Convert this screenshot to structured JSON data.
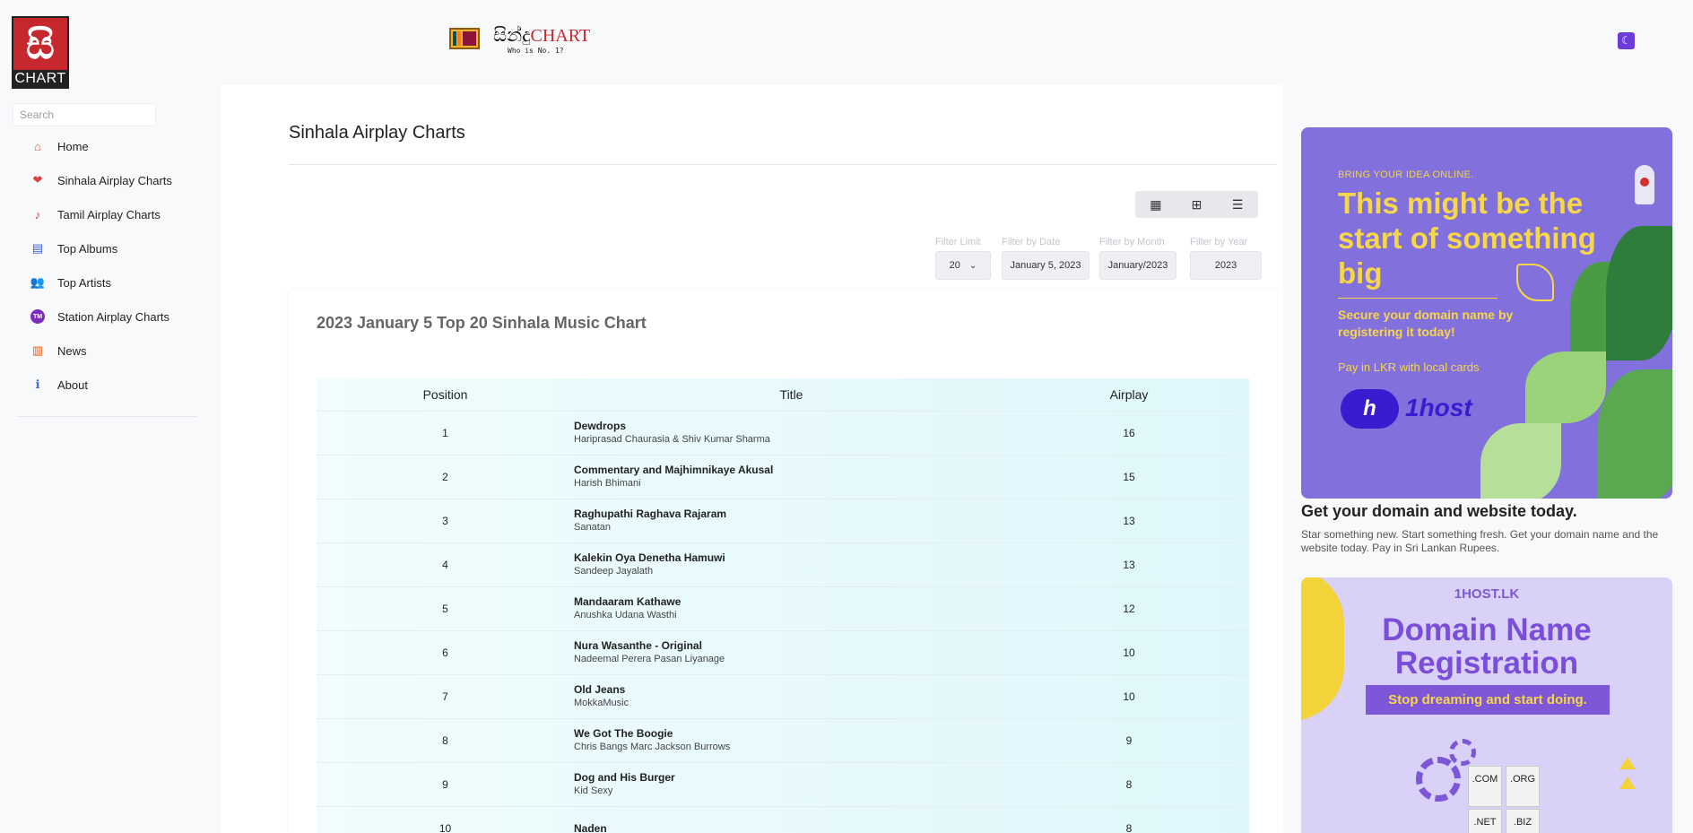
{
  "site": {
    "logo_glyph": "සි",
    "logo_text": "CHART",
    "brand_sinhala": "සින්දු",
    "brand_chart": "CHART",
    "tagline": "Who is No. 1?"
  },
  "search": {
    "placeholder": "Search"
  },
  "sidebar": {
    "items": [
      {
        "label": "Home",
        "icon": "home-icon",
        "glyph": "⌂",
        "color": "#e05a3a"
      },
      {
        "label": "Sinhala Airplay Charts",
        "icon": "heart-icon",
        "glyph": "❤",
        "color": "#e03b3b"
      },
      {
        "label": "Tamil Airplay Charts",
        "icon": "music-note-icon",
        "glyph": "♪",
        "color": "#d6336c"
      },
      {
        "label": "Top Albums",
        "icon": "film-icon",
        "glyph": "▤",
        "color": "#3b5bdb"
      },
      {
        "label": "Top Artists",
        "icon": "users-icon",
        "glyph": "👥",
        "color": "#f08c00"
      },
      {
        "label": "Station Airplay Charts",
        "icon": "tm-badge-icon",
        "glyph": "TM",
        "color": "#7b2cbf"
      },
      {
        "label": "News",
        "icon": "books-icon",
        "glyph": "▥",
        "color": "#e8590c"
      },
      {
        "label": "About",
        "icon": "info-icon",
        "glyph": "ℹ",
        "color": "#4263eb"
      }
    ]
  },
  "page": {
    "title": "Sinhala Airplay Charts"
  },
  "filters": {
    "limit_label": "Filter Limit",
    "limit_value": "20",
    "date_label": "Filter by Date",
    "date_value": "January 5, 2023",
    "month_label": "Filter by Month",
    "month_value": "January/2023",
    "year_label": "Filter by Year",
    "year_value": "2023"
  },
  "chart": {
    "title": "2023 January 5 Top 20 Sinhala Music Chart",
    "columns": {
      "position": "Position",
      "title": "Title",
      "airplay": "Airplay"
    },
    "rows": [
      {
        "position": "1",
        "title": "Dewdrops",
        "artist": "Hariprasad Chaurasia & Shiv Kumar Sharma",
        "airplay": "16"
      },
      {
        "position": "2",
        "title": "Commentary and Majhimnikaye Akusal",
        "artist": "Harish Bhimani",
        "airplay": "15"
      },
      {
        "position": "3",
        "title": "Raghupathi Raghava Rajaram",
        "artist": "Sanatan",
        "airplay": "13"
      },
      {
        "position": "4",
        "title": "Kalekin Oya Denetha Hamuwi",
        "artist": "Sandeep Jayalath",
        "airplay": "13"
      },
      {
        "position": "5",
        "title": "Mandaaram Kathawe",
        "artist": "Anushka Udana Wasthi",
        "airplay": "12"
      },
      {
        "position": "6",
        "title": "Nura Wasanthe - Original",
        "artist": "Nadeemal Perera Pasan Liyanage",
        "airplay": "10"
      },
      {
        "position": "7",
        "title": "Old Jeans",
        "artist": "MokkaMusic",
        "airplay": "10"
      },
      {
        "position": "8",
        "title": "We Got The Boogie",
        "artist": "Chris Bangs Marc Jackson Burrows",
        "airplay": "9"
      },
      {
        "position": "9",
        "title": "Dog and His Burger",
        "artist": "Kid Sexy",
        "airplay": "8"
      },
      {
        "position": "10",
        "title": "Naden",
        "artist": "",
        "airplay": "8"
      }
    ]
  },
  "ads": {
    "ad1": {
      "top": "BRING YOUR IDEA ONLINE.",
      "headline": "This might be the start of something big",
      "sub": "Secure your domain name by registering it today!",
      "lkr": "Pay in LKR with local cards",
      "logo_mark": "h",
      "brand": "1host",
      "caption": "Get your domain and website today.",
      "desc": "Star something new. Start something fresh. Get your domain name and the website today. Pay in Sri Lankan Rupees."
    },
    "ad2": {
      "site": "1HOST.LK",
      "headline": "Domain Name Registration",
      "cta": "Stop dreaming and start doing.",
      "tlds": [
        ".COM",
        ".ORG",
        ".NET",
        ".BIZ"
      ]
    }
  },
  "colors": {
    "accent": "#6d3bd8",
    "brand_red": "#c7282e",
    "chart_bg": "#e6f9fc"
  }
}
